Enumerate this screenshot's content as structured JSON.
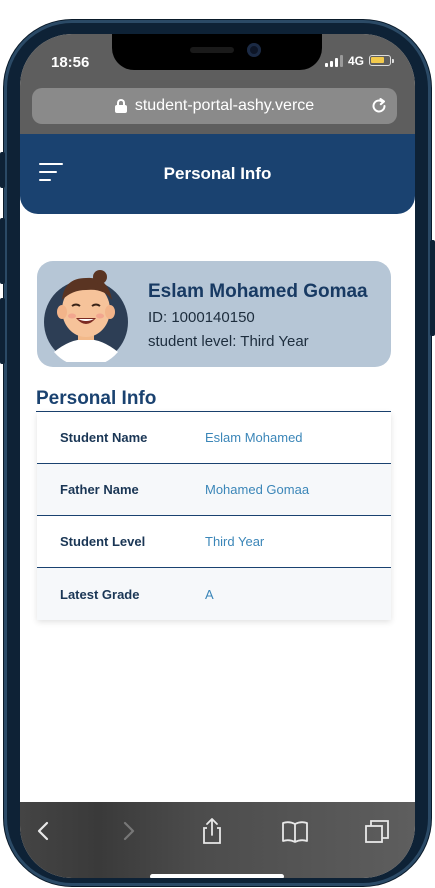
{
  "status_bar": {
    "time": "18:56",
    "network": "4G",
    "battery_level": 0.75,
    "battery_color": "#f2c94c"
  },
  "browser": {
    "url": "student-portal-ashy.verce",
    "icons": [
      "lock-icon",
      "reload-icon"
    ]
  },
  "header": {
    "title": "Personal Info",
    "menu_icon": "hamburger-menu-icon",
    "background": "#1a4270"
  },
  "profile": {
    "name": "Eslam Mohamed Gomaa",
    "id_line": "ID: 1000140150",
    "level_line": "student level: Third Year",
    "card_color": "#b6c6d6"
  },
  "info": {
    "title": "Personal Info",
    "rows": [
      {
        "label": "Student Name",
        "value": "Eslam Mohamed"
      },
      {
        "label": "Father Name",
        "value": "Mohamed Gomaa"
      },
      {
        "label": "Student Level",
        "value": "Third Year"
      },
      {
        "label": "Latest Grade",
        "value": "A"
      }
    ]
  },
  "toolbar": {
    "icons": [
      "back-icon",
      "forward-icon",
      "share-icon",
      "bookmarks-icon",
      "tabs-icon"
    ]
  }
}
